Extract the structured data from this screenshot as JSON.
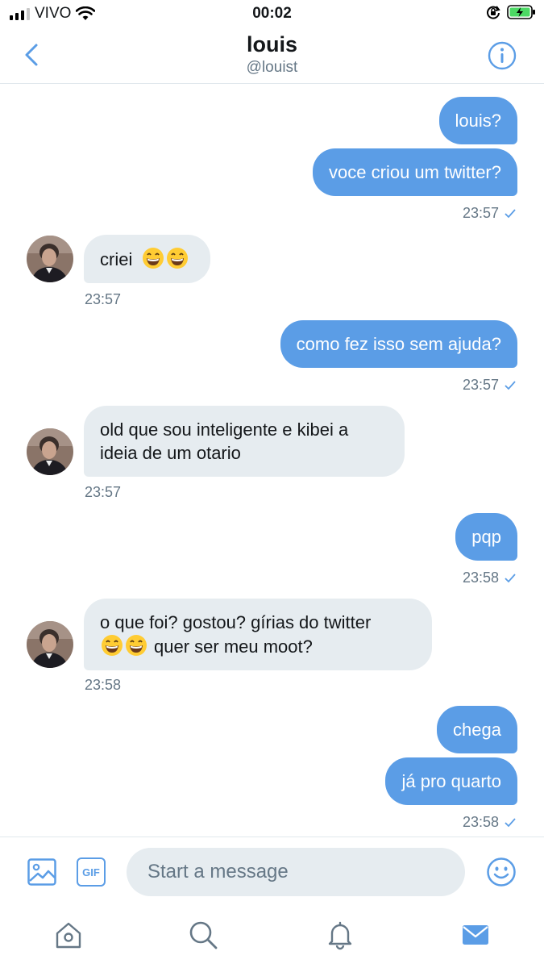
{
  "status_bar": {
    "carrier": "VIVO",
    "time": "00:02"
  },
  "header": {
    "title": "louis",
    "handle": "@louist"
  },
  "conversation": {
    "messages": [
      {
        "id": "m1",
        "direction": "outgoing",
        "text": "louis?"
      },
      {
        "id": "m2",
        "direction": "outgoing",
        "text": "voce criou um twitter?",
        "time": "23:57"
      },
      {
        "id": "m3",
        "direction": "incoming",
        "text": "criei",
        "emoji_after": [
          "grinning-face-with-smiling-eyes",
          "grinning-face-with-smiling-eyes"
        ],
        "time": "23:57"
      },
      {
        "id": "m4",
        "direction": "outgoing",
        "text": "como fez isso sem ajuda?",
        "time": "23:57"
      },
      {
        "id": "m5",
        "direction": "incoming",
        "line1": "old que sou inteligente e kibei a",
        "line2": "ideia de um otario",
        "time": "23:57"
      },
      {
        "id": "m6",
        "direction": "outgoing",
        "text": "pqp",
        "time": "23:58"
      },
      {
        "id": "m7",
        "direction": "incoming",
        "line1": "o que foi? gostou? gírias do twitter",
        "line2": "quer ser meu moot?",
        "emoji_before_line2": [
          "grinning-face-with-smiling-eyes",
          "grinning-face-with-smiling-eyes"
        ],
        "time": "23:58"
      },
      {
        "id": "m8",
        "direction": "outgoing",
        "text": "chega"
      },
      {
        "id": "m9",
        "direction": "outgoing",
        "text": "já pro quarto",
        "time": "23:58"
      }
    ]
  },
  "composer": {
    "placeholder": "Start a message",
    "gif_label": "GIF"
  },
  "colors": {
    "accent": "#5b9de6",
    "incoming_bubble": "#e6ecf0",
    "muted_text": "#657786"
  },
  "icons": {
    "status": [
      "signal-icon",
      "wifi-icon",
      "orientation-lock-icon",
      "battery-icon"
    ],
    "header": [
      "back-chevron-icon",
      "info-icon"
    ],
    "composer": [
      "image-icon",
      "gif-icon",
      "emoji-icon"
    ],
    "tabs": [
      "home-icon",
      "search-icon",
      "notifications-icon",
      "messages-icon"
    ]
  }
}
